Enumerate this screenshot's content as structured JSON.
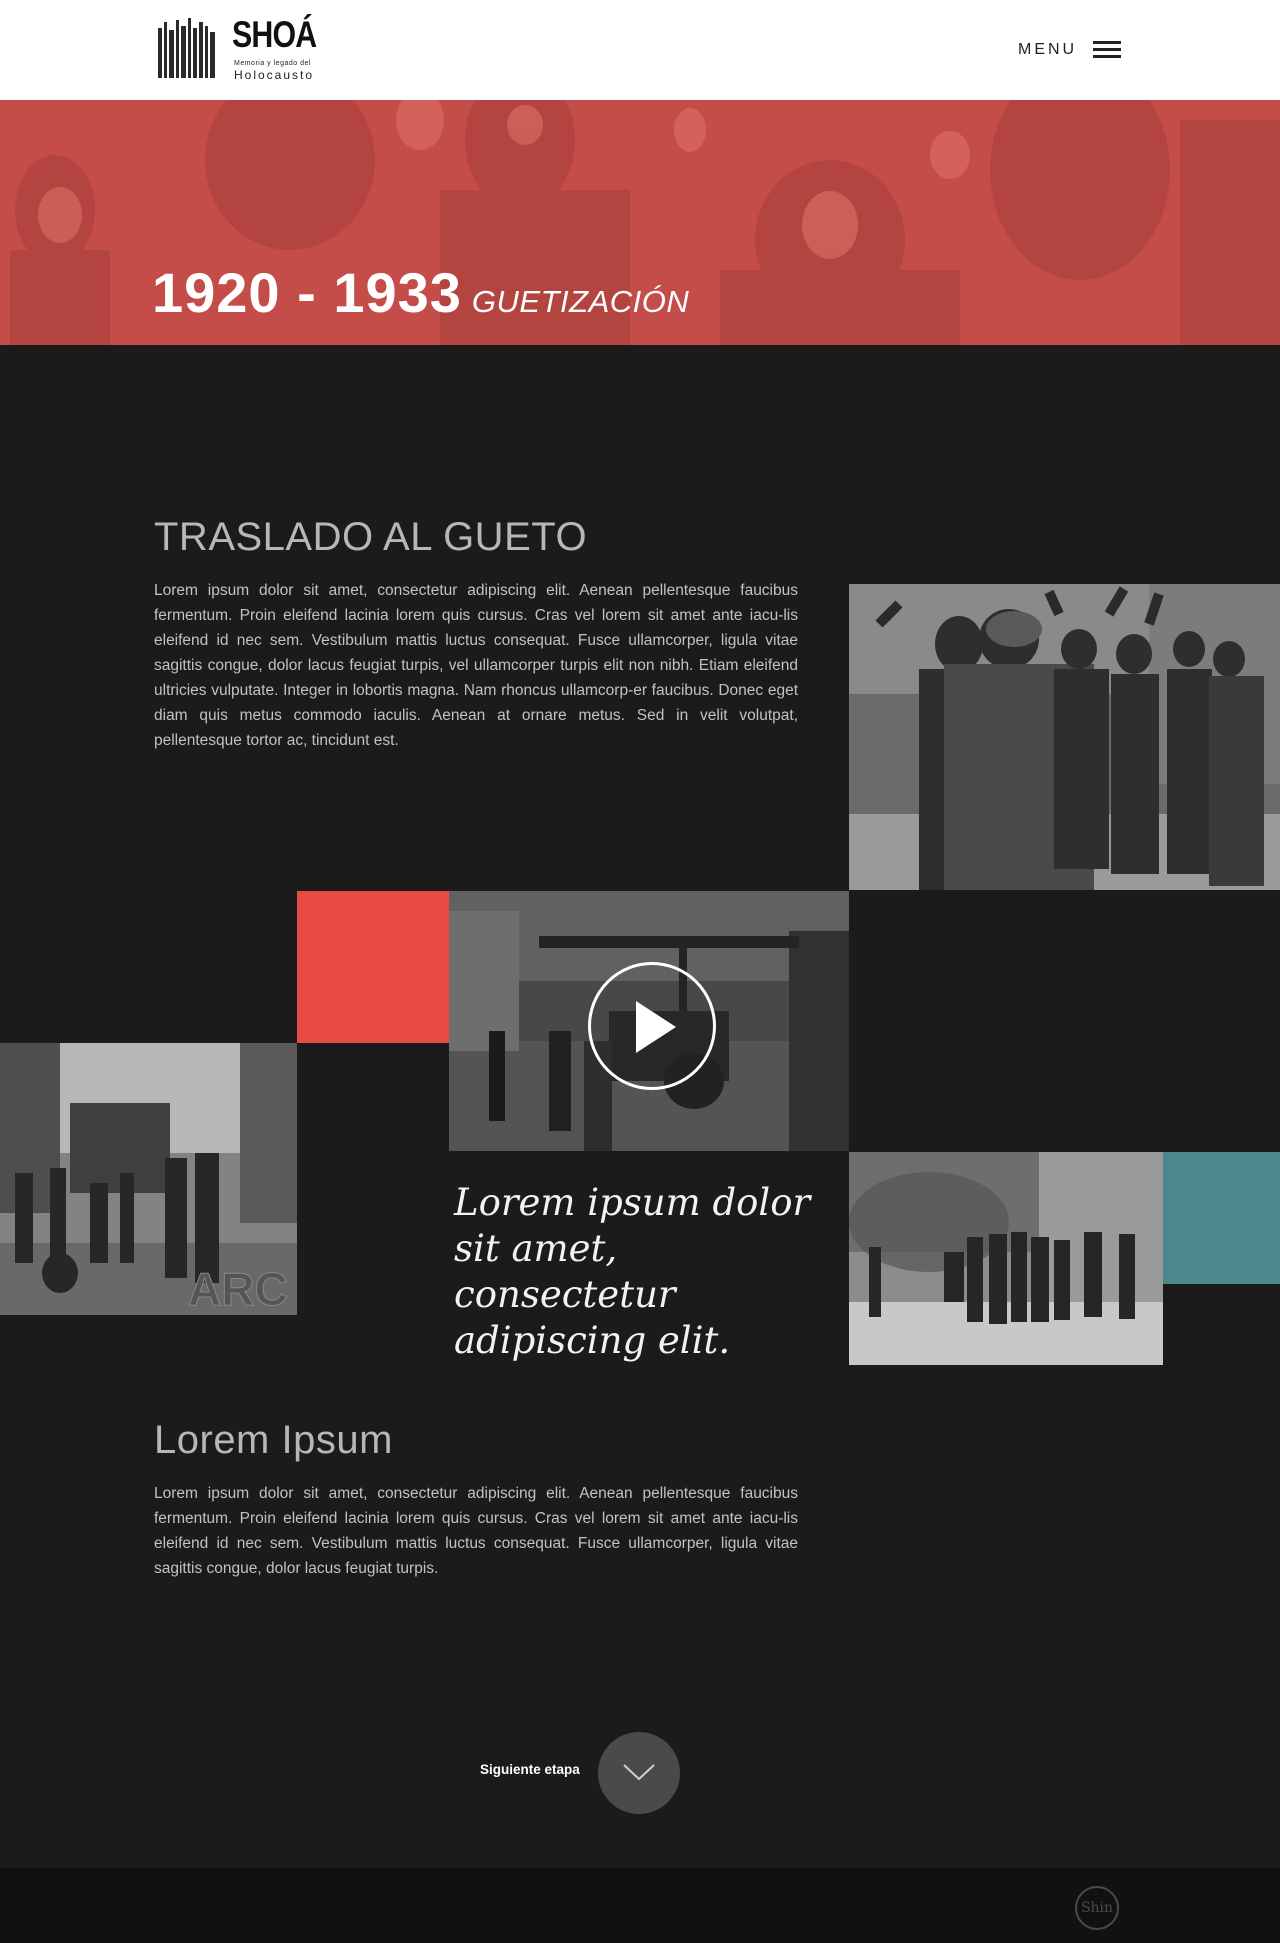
{
  "header": {
    "logo_title": "SHOÁ",
    "logo_subtitle": "Memoria y legado del",
    "logo_subtitle2": "Holocausto",
    "menu_label": "MENU"
  },
  "hero": {
    "years": "1920 - 1933",
    "stage": "GUETIZACIÓN",
    "tint_color": "#c9504b"
  },
  "section1": {
    "title": "TRASLADO AL GUETO",
    "text": "Lorem ipsum dolor sit amet, consectetur adipiscing elit. Aenean pellentesque faucibus fermentum. Proin eleifend lacinia lorem quis cursus. Cras vel lorem sit amet ante iacu-lis eleifend id nec sem. Vestibulum mattis luctus consequat. Fusce ullamcorper, ligula vitae sagittis congue, dolor lacus feugiat turpis, vel ullamcorper turpis elit non nibh. Etiam eleifend ultricies vulputate. Integer in lobortis magna. Nam rhoncus ullamcorp-er faucibus. Donec eget diam quis metus commodo iaculis. Aenean at ornare metus. Sed in velit volutpat, pellentesque tortor ac, tincidunt est."
  },
  "gallery": {
    "photo_left_watermark": "ARC",
    "accent_red": "#e84b43",
    "accent_teal": "#4e878b",
    "video_icon": "play-icon",
    "quote": "Lorem ipsum dolor sit amet, consectetur adipiscing elit."
  },
  "section2": {
    "title": "Lorem Ipsum",
    "text": "Lorem ipsum dolor sit amet, consectetur adipiscing elit. Aenean pellentesque faucibus fermentum. Proin eleifend lacinia lorem quis cursus. Cras vel lorem sit amet ante iacu-lis eleifend id nec sem. Vestibulum mattis luctus consequat. Fusce ullamcorper, ligula vitae sagittis congue, dolor lacus feugiat turpis."
  },
  "next": {
    "label": "Siguiente etapa",
    "icon": "chevron-down-icon"
  },
  "footer": {
    "logo_text": "Shin"
  }
}
